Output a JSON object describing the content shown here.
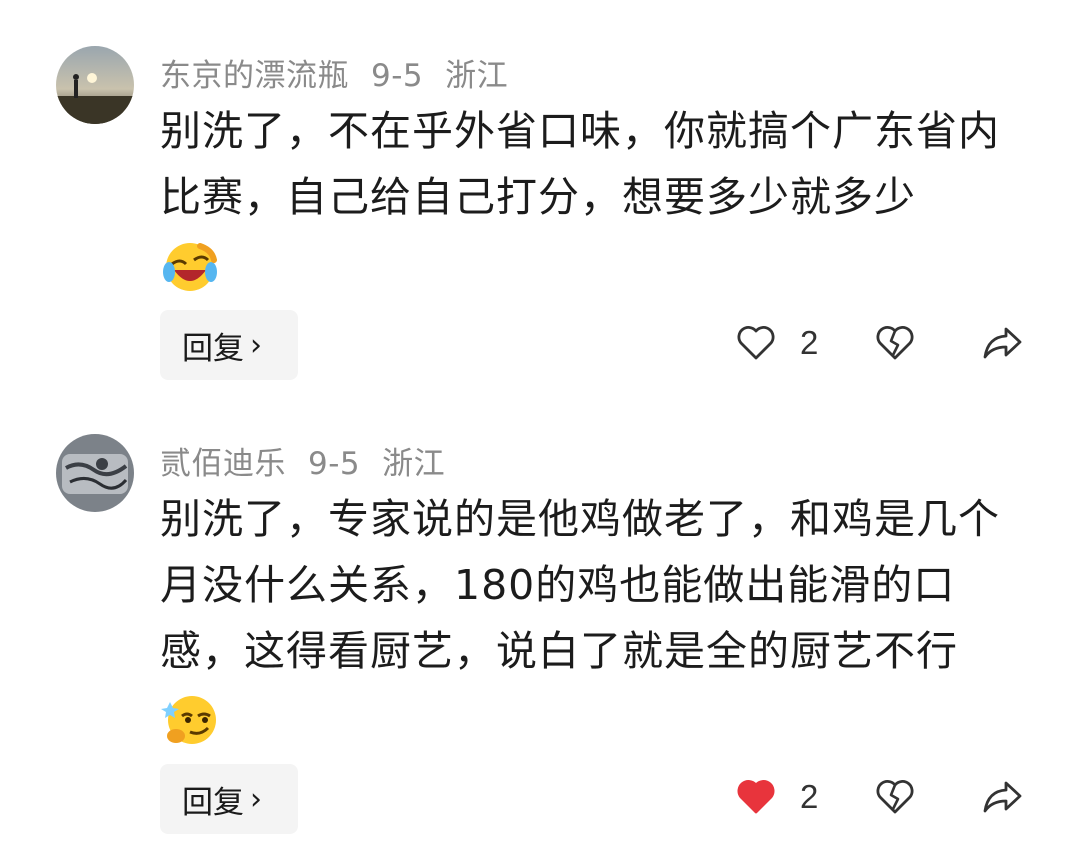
{
  "comments": [
    {
      "username": "东京的漂流瓶",
      "date": "9-5",
      "location": "浙江",
      "text": "别洗了，不在乎外省口味，你就搞个广东省内比赛，自己给自己打分，想要多少就多少",
      "emoji": "laughing-crying-emoji",
      "reply_label": "回复",
      "like_count": "2",
      "liked": false
    },
    {
      "username": "贰佰迪乐",
      "date": "9-5",
      "location": "浙江",
      "text": "别洗了，专家说的是他鸡做老了，和鸡是几个月没什么关系，180的鸡也能做出能滑的口感，这得看厨艺，说白了就是全的厨艺不行",
      "emoji": "smug-thinking-emoji",
      "reply_label": "回复",
      "like_count": "2",
      "liked": true
    }
  ],
  "colors": {
    "liked_heart": "#e8343c",
    "icon_stroke": "#333333",
    "meta_text": "#8a8a8a"
  }
}
